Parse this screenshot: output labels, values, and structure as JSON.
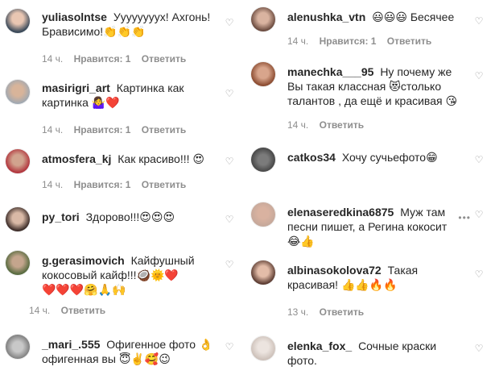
{
  "labels": {
    "likes": "Нравится: 1",
    "reply": "Ответить"
  },
  "left": [
    {
      "username": "yuliasolntse",
      "text": "Уууууууух! Ахгонь! Брависимо!👏👏👏",
      "time": "14 ч."
    },
    {
      "username": "masirigri_art",
      "text": "Картинка как картинка 🤷‍♀️❤️",
      "time": "14 ч."
    },
    {
      "username": "atmosfera_kj",
      "text": "Как красиво!!! 😍",
      "time": "14 ч."
    },
    {
      "username": "py_tori",
      "text": "Здорово!!!😍😍😍"
    },
    {
      "username": "g.gerasimovich",
      "text": "Кайфушный кокосовый кайф!!!🥥🌞❤️\n❤️❤️❤️🤗🙏🙌",
      "time": "14 ч."
    },
    {
      "username": "_mari_.555",
      "text": "Офигенное фото 👌 офигенная вы 😇✌️🥰😉"
    }
  ],
  "right": [
    {
      "username": "alenushka_vtn",
      "text": "😃😃😃 Бесячее",
      "time": "14 ч."
    },
    {
      "username": "manechka___95",
      "text": "Ну почему же Вы такая классная 😻столько талантов , да ещё и красивая 😘",
      "time": "14 ч."
    },
    {
      "username": "catkos34",
      "text": "Хочу сучьефото😁"
    },
    {
      "username": "elenaseredkina6875",
      "text": "Муж там песни пишет, а Регина кокосит\n😂👍"
    },
    {
      "username": "albinasokolova72",
      "text": "Такая красивая! 👍👍🔥🔥",
      "time": "13 ч."
    },
    {
      "username": "elenka_fox_",
      "text": "Сочные краски фото."
    }
  ]
}
